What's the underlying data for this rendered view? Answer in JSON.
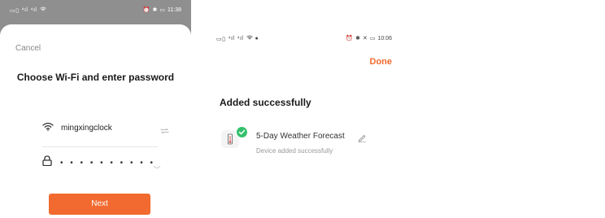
{
  "left_screen": {
    "status_time": "11:38",
    "cancel_label": "Cancel",
    "title": "Choose Wi-Fi and enter password",
    "wifi_name": "mingxingclock",
    "password_masked": "• • • • • • • • • •",
    "next_label": "Next"
  },
  "right_screen": {
    "status_time": "10:06",
    "done_label": "Done",
    "title": "Added successfully",
    "device_name": "5-Day Weather Forecast",
    "device_status": "Device added successfully"
  },
  "colors": {
    "accent": "#f26a2f",
    "success": "#34c06b"
  }
}
